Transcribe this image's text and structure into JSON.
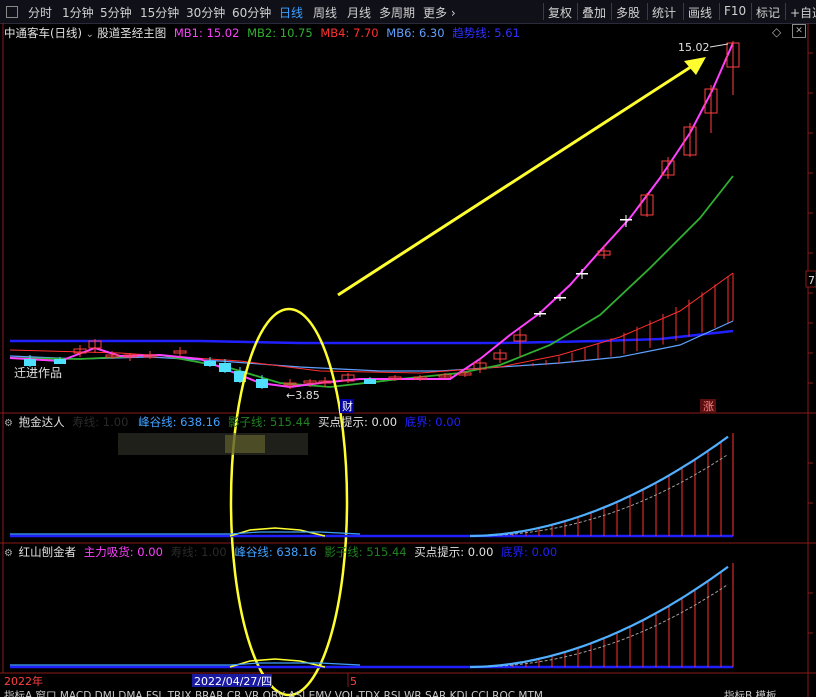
{
  "toolbar": {
    "periods": [
      "分时",
      "1分钟",
      "5分钟",
      "15分钟",
      "30分钟",
      "60分钟",
      "日线",
      "周线",
      "月线",
      "多周期",
      "更多"
    ],
    "active_period": "日线",
    "right_buttons": [
      "复权",
      "叠加",
      "多股",
      "统计",
      "画线",
      "F10",
      "标记",
      "+自选"
    ]
  },
  "main_panel": {
    "stock_name": "中通客车(日线)",
    "indicator": "股道圣经主图",
    "mb1": "MB1: 15.02",
    "mb2": "MB2: 10.75",
    "mb4": "MB4: 7.70",
    "mb6": "MB6: 6.30",
    "trend": "趋势线: 5.61",
    "high_label": "15.02",
    "low_label": "3.85",
    "watermark": "迁进作品",
    "tag_cai": "财",
    "tag_zhang": "涨",
    "right_tag": "7",
    "colors": {
      "mb1": "#ff40ff",
      "mb2": "#30b030",
      "mb4": "#ff3030",
      "mb6": "#60a0ff",
      "trend": "#2020ff",
      "annotation": "#ffff30"
    }
  },
  "panel2": {
    "title": "抱金达人",
    "faded": "寿线: 1.00",
    "fenggu": "峰谷线: 638.16",
    "yingzi": "影子线: 515.44",
    "maidian": "买点提示: 0.00",
    "dijie": "底界: 0.00"
  },
  "panel3": {
    "title": "红山刨金者",
    "zhuli": "主力吸货: 0.00",
    "faded": "寿线: 1.00",
    "fenggu": "峰谷线: 638.16",
    "yingzi": "影子线: 515.44",
    "maidian": "买点提示: 0.00",
    "dijie": "底界: 0.00"
  },
  "axis": {
    "year": "2022年",
    "date": "2022/04/27/四",
    "tick5": "5"
  },
  "bottom_tabs": "指标A 窗口 MACD DMI DMA FSL TRIX BRAR CR VR OBV ASI EMV VOL-TDX RSI WR SAR KDJ CCI ROC MTM",
  "bottom_right": "指标B 模板"
}
